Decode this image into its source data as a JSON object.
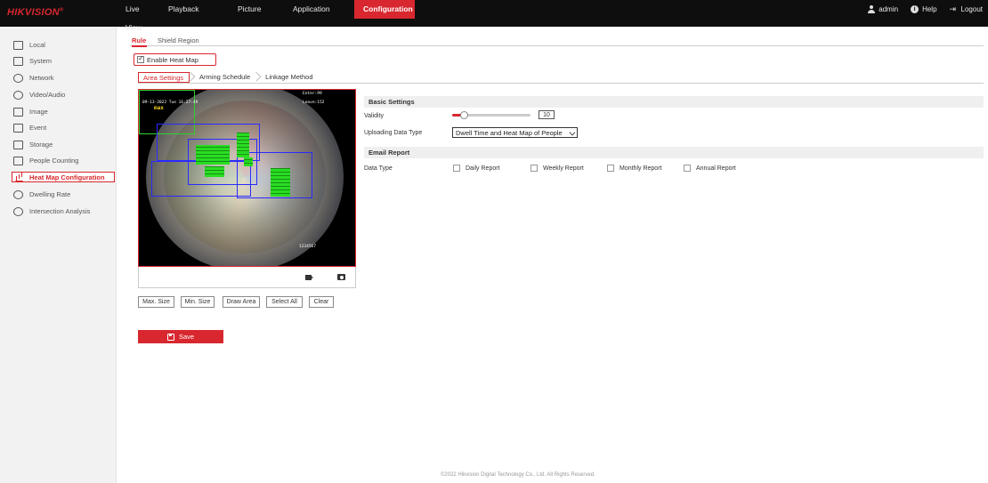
{
  "brand": "HIKVISION",
  "nav": {
    "items": [
      {
        "label": "Live View"
      },
      {
        "label": "Playback"
      },
      {
        "label": "Picture"
      },
      {
        "label": "Application"
      },
      {
        "label": "Configuration"
      }
    ],
    "active": "Configuration"
  },
  "topright": {
    "user": "admin",
    "help": "Help",
    "logout": "Logout"
  },
  "sidebar": {
    "items": [
      {
        "label": "Local",
        "icon": "monitor-icon"
      },
      {
        "label": "System",
        "icon": "system-icon"
      },
      {
        "label": "Network",
        "icon": "globe-icon"
      },
      {
        "label": "Video/Audio",
        "icon": "video-audio-icon"
      },
      {
        "label": "Image",
        "icon": "image-icon"
      },
      {
        "label": "Event",
        "icon": "calendar-icon"
      },
      {
        "label": "Storage",
        "icon": "storage-icon"
      },
      {
        "label": "People Counting",
        "icon": "people-counting-icon"
      },
      {
        "label": "Heat Map Configuration",
        "icon": "bar-chart-icon"
      },
      {
        "label": "Dwelling Rate",
        "icon": "dwelling-icon"
      },
      {
        "label": "Intersection Analysis",
        "icon": "intersection-icon"
      }
    ],
    "active": "Heat Map Configuration"
  },
  "subtabs": [
    {
      "label": "Rule"
    },
    {
      "label": "Shield Region"
    }
  ],
  "enable_heatmap": {
    "label": "Enable Heat Map",
    "checked": true
  },
  "steps": [
    {
      "label": "Area Settings"
    },
    {
      "label": "Arming Schedule"
    },
    {
      "label": "Linkage Method"
    }
  ],
  "video": {
    "timestamp": "09-13-2022 Tue 16:27:49",
    "max_label": "max",
    "enter": "Enter:99",
    "leave": "Leave:152",
    "watermark": "1234567"
  },
  "area_buttons": [
    {
      "label": "Max. Size"
    },
    {
      "label": "Min. Size"
    },
    {
      "label": "Draw Area"
    },
    {
      "label": "Select All"
    },
    {
      "label": "Clear"
    }
  ],
  "save_label": "Save",
  "basic": {
    "title": "Basic Settings",
    "validity_label": "Validity",
    "validity_value": "10",
    "validity_fraction": 0.15,
    "upload_label": "Uploading Data Type",
    "upload_value": "Dwell Time and Heat Map of People"
  },
  "email": {
    "title": "Email Report",
    "data_type_label": "Data Type",
    "options": [
      {
        "label": "Daily Report"
      },
      {
        "label": "Weekly Report"
      },
      {
        "label": "Monthly Report"
      },
      {
        "label": "Annual Report"
      }
    ]
  },
  "footer": "©2022 Hikvision Digital Technology Co., Ltd. All Rights Reserved.",
  "colors": {
    "accent": "#d8272f",
    "topbar": "#0e0e0e",
    "heat": "#21e01b",
    "zone": "#2a2aff"
  }
}
